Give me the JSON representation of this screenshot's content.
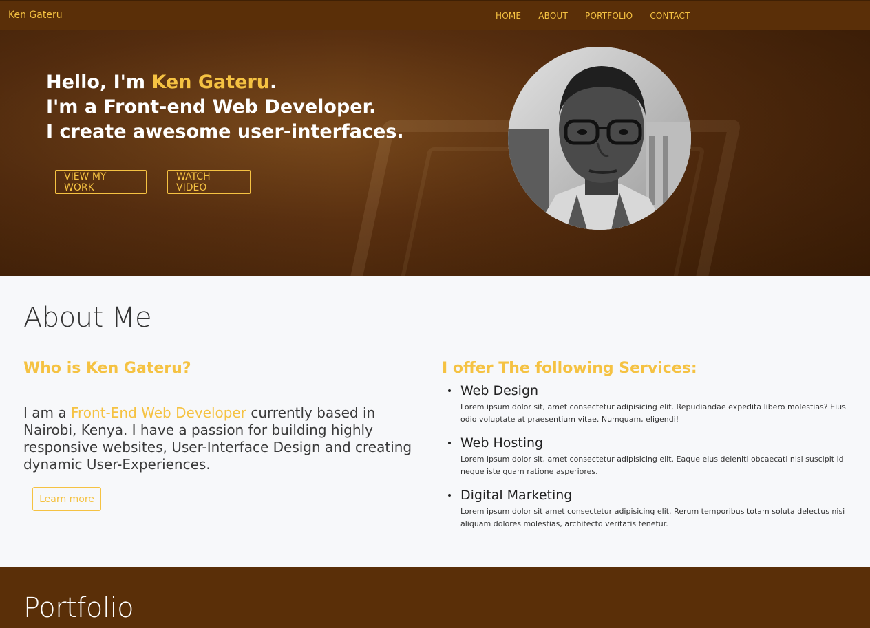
{
  "navbar": {
    "brand": "Ken Gateru",
    "links": [
      "HOME",
      "ABOUT",
      "PORTFOLIO",
      "CONTACT"
    ]
  },
  "hero": {
    "greeting_prefix": "Hello, I'm ",
    "name": "Ken Gateru",
    "greeting_suffix": ".",
    "line2": "I'm a Front-end Web Developer.",
    "line3": "I create awesome user-interfaces.",
    "btn_work": "VIEW MY WORK",
    "btn_video": "WATCH VIDEO"
  },
  "about": {
    "title": "About Me",
    "who_heading": "Who is Ken Gateru?",
    "bio_prefix": "I am a ",
    "bio_highlight": "Front-End Web Developer",
    "bio_suffix": " currently based in Nairobi, Kenya. I have a passion for building highly responsive websites, User-Interface Design and creating dynamic User-Experiences.",
    "learn_more": "Learn more",
    "services_heading": "I offer The following Services:",
    "services": [
      {
        "title": "Web Design",
        "desc": "Lorem ipsum dolor sit, amet consectetur adipisicing elit. Repudiandae expedita libero molestias? Eius odio voluptate at praesentium vitae. Numquam, eligendi!"
      },
      {
        "title": "Web Hosting",
        "desc": "Lorem ipsum dolor sit, amet consectetur adipisicing elit. Eaque eius deleniti obcaecati nisi suscipit id neque iste quam ratione asperiores."
      },
      {
        "title": "Digital Marketing",
        "desc": "Lorem ipsum dolor sit amet consectetur adipisicing elit. Rerum temporibus totam soluta delectus nisi aliquam dolores molestias, architecto veritatis tenetur."
      }
    ]
  },
  "portfolio": {
    "title": "Portfolio"
  },
  "colors": {
    "accent": "#f5c242",
    "brown": "#5a2f08"
  },
  "icons": {
    "portrait": "profile-photo"
  }
}
